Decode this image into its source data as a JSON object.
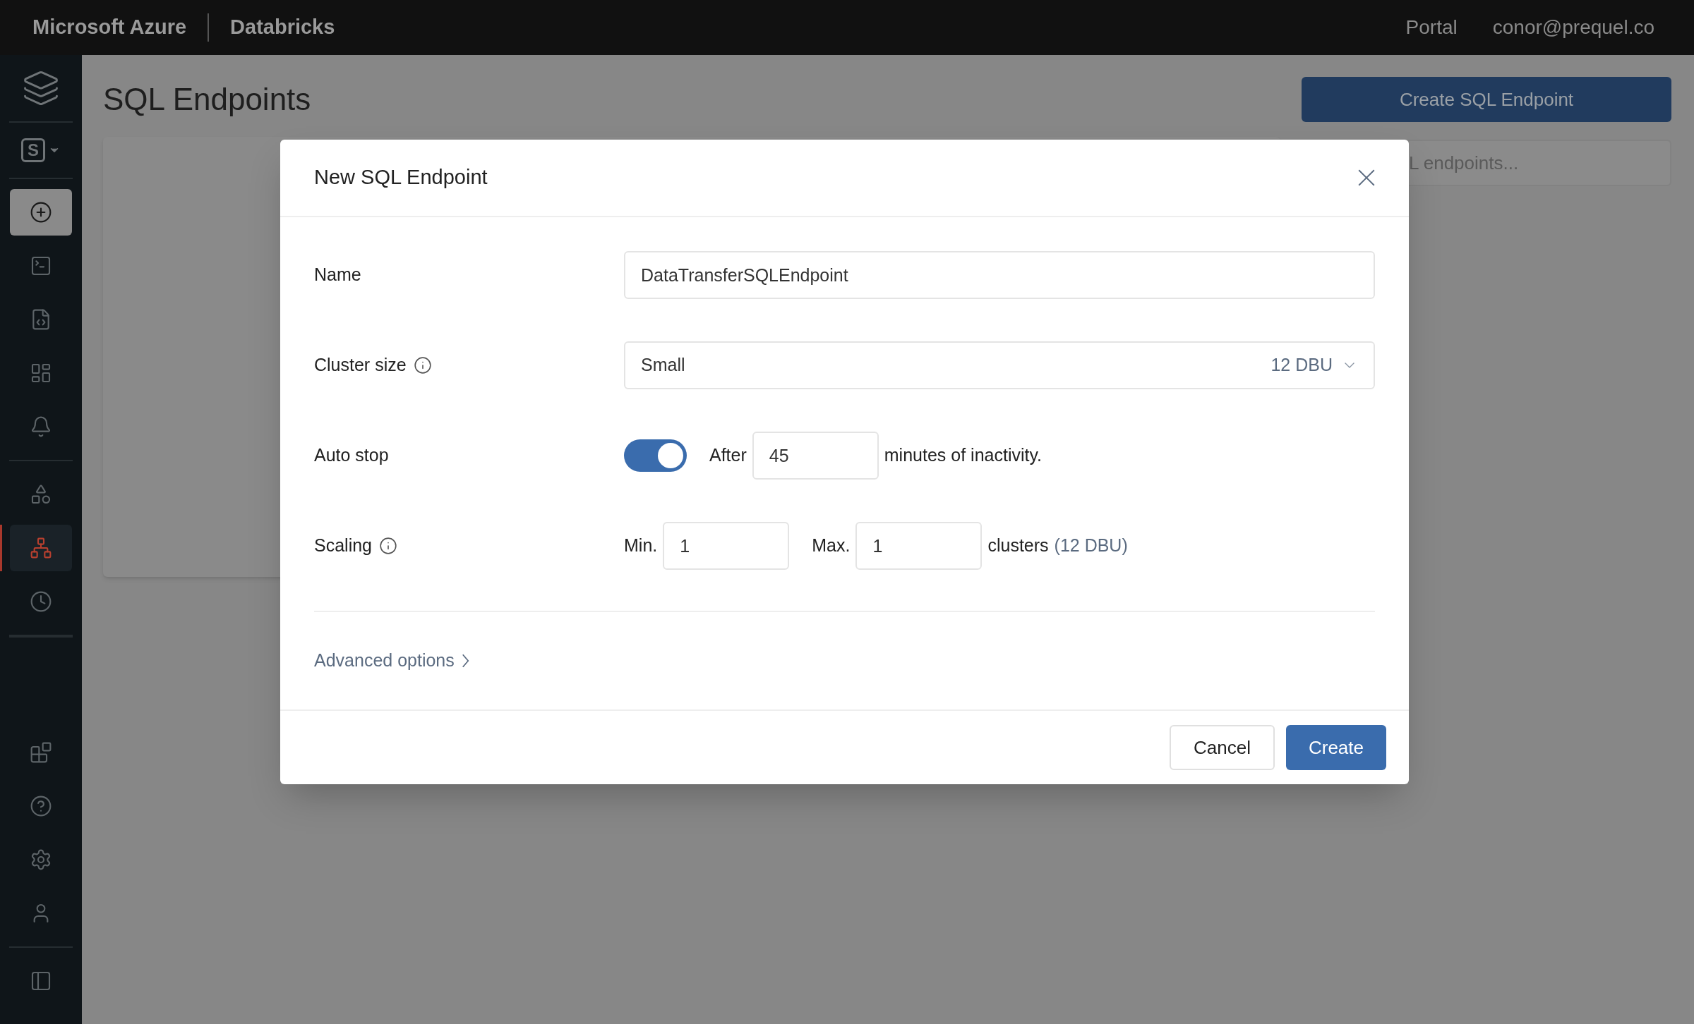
{
  "top_bar": {
    "product": "Microsoft Azure",
    "workspace": "Databricks",
    "links": [
      "Portal",
      "conor@prequel.co"
    ]
  },
  "sidebar": {
    "switcher_letter": "S",
    "groups": [
      {
        "items": [
          {
            "kind": "create",
            "selected": false
          },
          {
            "kind": "editor",
            "selected": false
          },
          {
            "kind": "queries",
            "selected": false
          },
          {
            "kind": "dashboards",
            "selected": false
          },
          {
            "kind": "alerts",
            "selected": false
          }
        ]
      },
      {
        "items": [
          {
            "kind": "data",
            "selected": false
          },
          {
            "kind": "endpoints",
            "selected": true
          },
          {
            "kind": "history",
            "selected": false
          }
        ]
      },
      {
        "items": [
          {
            "kind": "partner",
            "selected": false
          },
          {
            "kind": "help",
            "selected": false
          },
          {
            "kind": "settings",
            "selected": false
          },
          {
            "kind": "account",
            "selected": false
          }
        ]
      },
      {
        "items": [
          {
            "kind": "collapse",
            "selected": false
          }
        ]
      }
    ]
  },
  "page": {
    "title": "SQL Endpoints",
    "create_button": "Create SQL Endpoint",
    "search": {
      "placeholder": "L endpoints..."
    }
  },
  "dialog": {
    "title": "New SQL Endpoint",
    "name": {
      "label": "Name",
      "value": "DataTransferSQLEndpoint"
    },
    "cluster_size": {
      "label": "Cluster size",
      "value": "Small",
      "dbu": "12 DBU"
    },
    "auto_stop": {
      "label": "Auto stop",
      "on": true,
      "prefix": "After",
      "value": "45",
      "suffix": "minutes of inactivity."
    },
    "scaling": {
      "label": "Scaling",
      "min_label": "Min.",
      "min": "1",
      "max_label": "Max.",
      "max": "1",
      "suffix": "clusters",
      "note": "(12 DBU)"
    },
    "advanced": "Advanced options",
    "buttons": [
      {
        "label": "Cancel",
        "kind": "secondary"
      },
      {
        "label": "Create",
        "kind": "primary"
      }
    ]
  }
}
